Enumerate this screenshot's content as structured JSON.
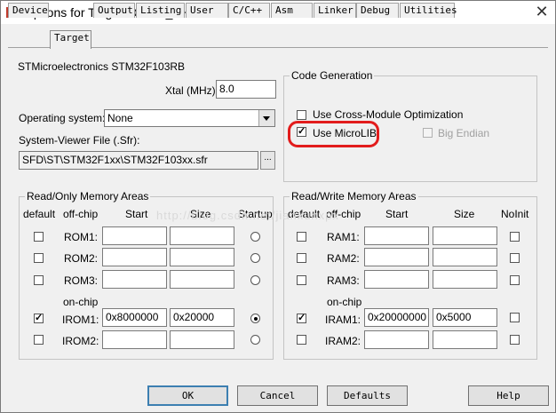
{
  "window": {
    "title": "Options for Target 'DEMO_SHELL'",
    "close_glyph": "✕"
  },
  "tabs": [
    "Device",
    "Target",
    "Output",
    "Listing",
    "User",
    "C/C++",
    "Asm",
    "Linker",
    "Debug",
    "Utilities"
  ],
  "active_tab": "Target",
  "device_name": "STMicroelectronics STM32F103RB",
  "xtal": {
    "label": "Xtal (MHz):",
    "value": "8.0"
  },
  "os": {
    "label": "Operating system:",
    "value": "None"
  },
  "sysview": {
    "label": "System-Viewer File (.Sfr):",
    "value": "SFD\\ST\\STM32F1xx\\STM32F103xx.sfr",
    "browse_label": "..."
  },
  "codegen": {
    "title": "Code Generation",
    "cross_module": {
      "label": "Use Cross-Module Optimization",
      "checked": false
    },
    "microlib": {
      "label": "Use MicroLIB",
      "checked": true
    },
    "big_endian": {
      "label": "Big Endian",
      "checked": false,
      "disabled": true
    }
  },
  "rom": {
    "title": "Read/Only Memory Areas",
    "headers": {
      "default": "default",
      "offchip": "off-chip",
      "start": "Start",
      "size": "Size",
      "startup": "Startup"
    },
    "onchip_label": "on-chip",
    "rows": [
      {
        "label": "ROM1:",
        "start": "",
        "size": "",
        "default": false,
        "startup": false
      },
      {
        "label": "ROM2:",
        "start": "",
        "size": "",
        "default": false,
        "startup": false
      },
      {
        "label": "ROM3:",
        "start": "",
        "size": "",
        "default": false,
        "startup": false
      },
      {
        "label": "IROM1:",
        "start": "0x8000000",
        "size": "0x20000",
        "default": true,
        "startup": true
      },
      {
        "label": "IROM2:",
        "start": "",
        "size": "",
        "default": false,
        "startup": false
      }
    ]
  },
  "ram": {
    "title": "Read/Write Memory Areas",
    "headers": {
      "default": "default",
      "offchip": "off-chip",
      "start": "Start",
      "size": "Size",
      "noinit": "NoInit"
    },
    "onchip_label": "on-chip",
    "rows": [
      {
        "label": "RAM1:",
        "start": "",
        "size": "",
        "default": false,
        "noinit": false
      },
      {
        "label": "RAM2:",
        "start": "",
        "size": "",
        "default": false,
        "noinit": false
      },
      {
        "label": "RAM3:",
        "start": "",
        "size": "",
        "default": false,
        "noinit": false
      },
      {
        "label": "IRAM1:",
        "start": "0x20000000",
        "size": "0x5000",
        "default": true,
        "noinit": false
      },
      {
        "label": "IRAM2:",
        "start": "",
        "size": "",
        "default": false,
        "noinit": false
      }
    ]
  },
  "buttons": {
    "ok": "OK",
    "cancel": "Cancel",
    "defaults": "Defaults",
    "help": "Help"
  },
  "watermark": "http://blog.csdn.net/jianxunxpx",
  "colors": {
    "highlight": "#e21c1c",
    "default_button_border": "#3c7fb1"
  }
}
